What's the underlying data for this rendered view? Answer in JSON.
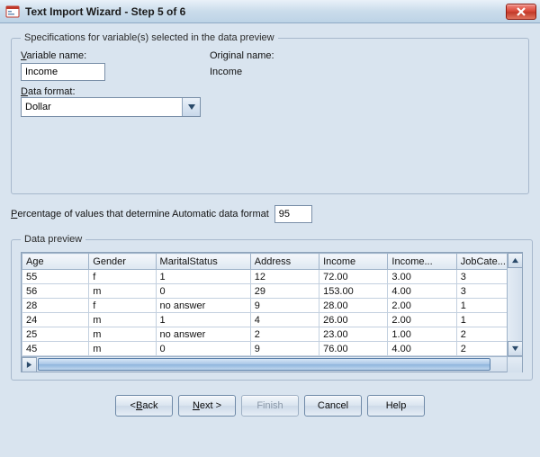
{
  "window": {
    "title": "Text Import Wizard - Step 5 of 6"
  },
  "spec": {
    "legend": "Specifications for variable(s) selected in the data preview",
    "variable_name_label_pre": "V",
    "variable_name_label_post": "ariable name:",
    "variable_name_value": "Income",
    "original_name_label": "Original name:",
    "original_name_value": "Income",
    "data_format_label_pre": "D",
    "data_format_label_post": "ata format:",
    "data_format_value": "Dollar"
  },
  "percent": {
    "label_pre": "P",
    "label_post": "ercentage of values that determine Automatic data format",
    "value": "95"
  },
  "preview": {
    "legend": "Data preview",
    "columns": [
      "Age",
      "Gender",
      "MaritalStatus",
      "Address",
      "Income",
      "Income...",
      "JobCate..."
    ],
    "rows": [
      [
        "55",
        "f",
        "1",
        "12",
        "72.00",
        "3.00",
        "3"
      ],
      [
        "56",
        "m",
        "0",
        "29",
        "153.00",
        "4.00",
        "3"
      ],
      [
        "28",
        "f",
        "no answer",
        "9",
        "28.00",
        "2.00",
        "1"
      ],
      [
        "24",
        "m",
        "1",
        "4",
        "26.00",
        "2.00",
        "1"
      ],
      [
        "25",
        "m",
        "no answer",
        "2",
        "23.00",
        "1.00",
        "2"
      ],
      [
        "45",
        "m",
        "0",
        "9",
        "76.00",
        "4.00",
        "2"
      ]
    ],
    "highlight_column_index": 4
  },
  "buttons": {
    "back": "ack",
    "back_pre": "< ",
    "back_u": "B",
    "next_u": "N",
    "next_post": "ext >",
    "finish": "Finish",
    "cancel": "Cancel",
    "help": "Help"
  }
}
